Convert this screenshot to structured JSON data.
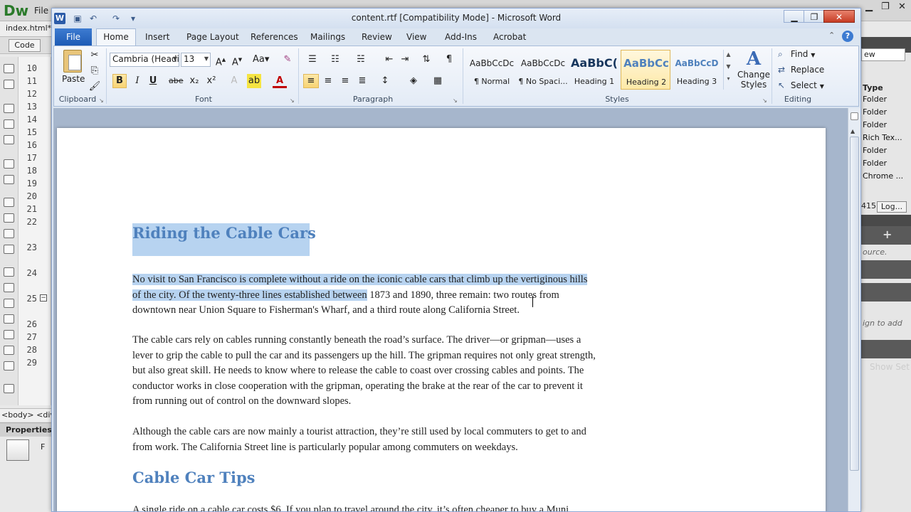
{
  "dreamweaver": {
    "logo": "Dw",
    "menu_file": "File",
    "tab": "index.html*",
    "code_button": "Code",
    "line_numbers": [
      "10",
      "11",
      "12",
      "13",
      "14",
      "15",
      "16",
      "17",
      "18",
      "19",
      "20",
      "21",
      "22",
      "23",
      "24",
      "25",
      "26",
      "27",
      "28",
      "29"
    ],
    "tag_bar": "<body> <div",
    "properties_label": "Properties",
    "properties_f": "F",
    "file_select": "ew",
    "type_header": "Type",
    "file_types": [
      "Folder",
      "Folder",
      "Folder",
      "Rich Tex...",
      "Folder",
      "Folder",
      "Chrome ..."
    ],
    "number_partial": "415",
    "log_button": "Log...",
    "source_text": "ource.",
    "sign_text": "ign to add",
    "show_set": "Show Set"
  },
  "word": {
    "title": "content.rtf [Compatibility Mode]  -  Microsoft Word",
    "app_icon": "W",
    "tabs": {
      "file": "File",
      "home": "Home",
      "insert": "Insert",
      "page_layout": "Page Layout",
      "references": "References",
      "mailings": "Mailings",
      "review": "Review",
      "view": "View",
      "addins": "Add-Ins",
      "acrobat": "Acrobat"
    },
    "help": "?",
    "ribbon": {
      "paste": "Paste",
      "clipboard": "Clipboard",
      "font_name": "Cambria (Headi",
      "font_size": "13",
      "font_group": "Font",
      "paragraph_group": "Paragraph",
      "styles_group": "Styles",
      "editing_group": "Editing",
      "bold": "B",
      "italic": "I",
      "underline": "U",
      "strike": "abe",
      "subscript": "x₂",
      "superscript": "x²",
      "styles": [
        {
          "preview": "AaBbCcDc",
          "name": "¶ Normal"
        },
        {
          "preview": "AaBbCcDc",
          "name": "¶ No Spaci..."
        },
        {
          "preview": "AaBbC(",
          "name": "Heading 1"
        },
        {
          "preview": "AaBbCc",
          "name": "Heading 2"
        },
        {
          "preview": "AaBbCcD",
          "name": "Heading 3"
        }
      ],
      "change_styles_line1": "Change",
      "change_styles_line2": "Styles",
      "find": "Find",
      "replace": "Replace",
      "select": "Select"
    },
    "document": {
      "heading1": "Riding the Cable Cars",
      "heading2": "Cable Car Tips",
      "p1_sel_l1": "No visit to San Francisco is complete without a ride on the iconic cable cars that climb up the vertiginous hills",
      "p1_sel_l2": "of the city. Of the twenty-three lines established between",
      "p1_rest_l2": " 1873 and 1890, three remain: two routes from",
      "p1_l3": "downtown near Union Square to Fisherman's Wharf, and a third route along California Street.",
      "p2_l1": "The cable cars rely on cables running constantly beneath the road’s surface. The driver—or gripman—uses a",
      "p2_l2": "lever to grip the cable to pull the car and its passengers up the hill. The gripman requires not only great strength,",
      "p2_l3": "but also great skill. He needs to know where to release the cable to coast over crossing cables and points. The",
      "p2_l4": "conductor works in close cooperation with the gripman, operating the brake at the rear of the car to prevent it",
      "p2_l5": "from running out of control on the downward slopes.",
      "p3_l1": "Although the cable cars are now mainly a tourist attraction, they’re still used by local commuters to get to and",
      "p3_l2": "from work. The California Street line is particularly popular among commuters on weekdays.",
      "p4_l1": "A single ride on a cable car costs $6. If you plan to travel around the city, it’s often cheaper to buy a Muni"
    }
  }
}
